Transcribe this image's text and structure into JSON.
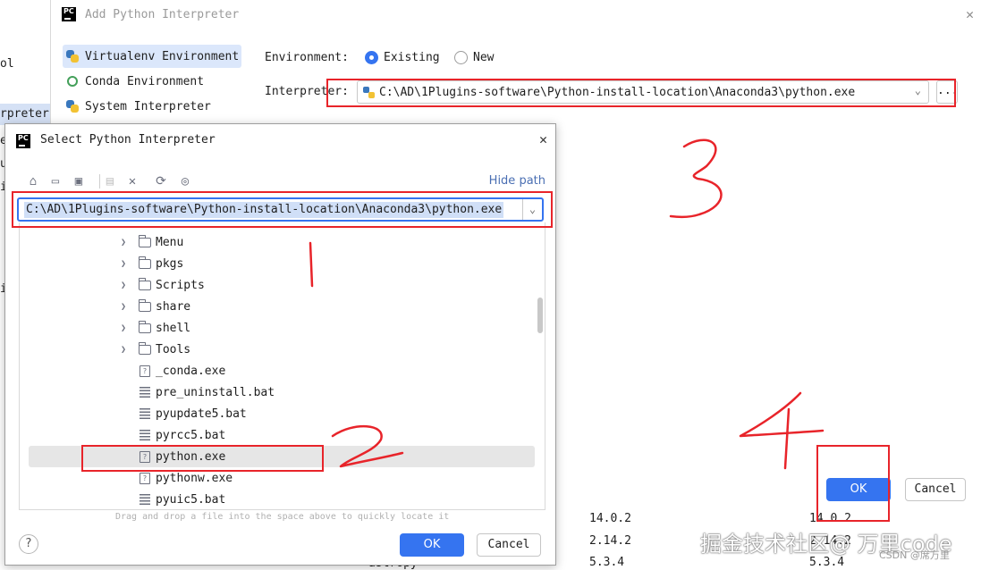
{
  "background": {
    "fragments": [
      "ol",
      "rpreter",
      "e",
      "u",
      "i",
      "i"
    ],
    "table_rows": [
      {
        "col1": "14.0.2",
        "col2": "14.0.2"
      },
      {
        "col1": "2.14.2",
        "col2": "2.14.2"
      },
      {
        "col0": "astropy",
        "col1": "5.3.4",
        "col2": "5.3.4"
      }
    ]
  },
  "add_dialog": {
    "title": "Add Python Interpreter",
    "env_list": [
      {
        "label": "Virtualenv Environment",
        "icon": "python-icon",
        "active": true
      },
      {
        "label": "Conda Environment",
        "icon": "conda-icon",
        "active": false
      },
      {
        "label": "System Interpreter",
        "icon": "python-icon",
        "active": false
      }
    ],
    "environment_label": "Environment:",
    "radio_existing": "Existing",
    "radio_new": "New",
    "interpreter_label": "Interpreter:",
    "interpreter_value": "C:\\AD\\1Plugins-software\\Python-install-location\\Anaconda3\\python.exe",
    "browse_label": "...",
    "ok_label": "OK",
    "cancel_label": "Cancel"
  },
  "select_dialog": {
    "title": "Select Python Interpreter",
    "hide_path": "Hide path",
    "path_value": "C:\\AD\\1Plugins-software\\Python-install-location\\Anaconda3\\python.exe",
    "toolbar_icons": [
      "home-icon",
      "desktop-icon",
      "project-icon",
      "new-folder-icon",
      "delete-icon",
      "refresh-icon",
      "show-hidden-icon"
    ],
    "tree": [
      {
        "label": "Menu",
        "type": "folder"
      },
      {
        "label": "pkgs",
        "type": "folder"
      },
      {
        "label": "Scripts",
        "type": "folder"
      },
      {
        "label": "share",
        "type": "folder"
      },
      {
        "label": "shell",
        "type": "folder"
      },
      {
        "label": "Tools",
        "type": "folder"
      },
      {
        "label": "_conda.exe",
        "type": "unknown"
      },
      {
        "label": "pre_uninstall.bat",
        "type": "text"
      },
      {
        "label": "pyupdate5.bat",
        "type": "text"
      },
      {
        "label": "pyrcc5.bat",
        "type": "text"
      },
      {
        "label": "python.exe",
        "type": "unknown",
        "selected": true
      },
      {
        "label": "pythonw.exe",
        "type": "unknown"
      },
      {
        "label": "pyuic5.bat",
        "type": "text"
      }
    ],
    "drop_hint": "Drag and drop a file into the space above to quickly locate it",
    "help_label": "?",
    "ok_label": "OK",
    "cancel_label": "Cancel"
  },
  "watermark": {
    "main": "掘金技术社区@ 万里code",
    "sub": "CSDN @席万里"
  },
  "colors": {
    "accent": "#3574f0",
    "annotation": "#e8242a"
  }
}
